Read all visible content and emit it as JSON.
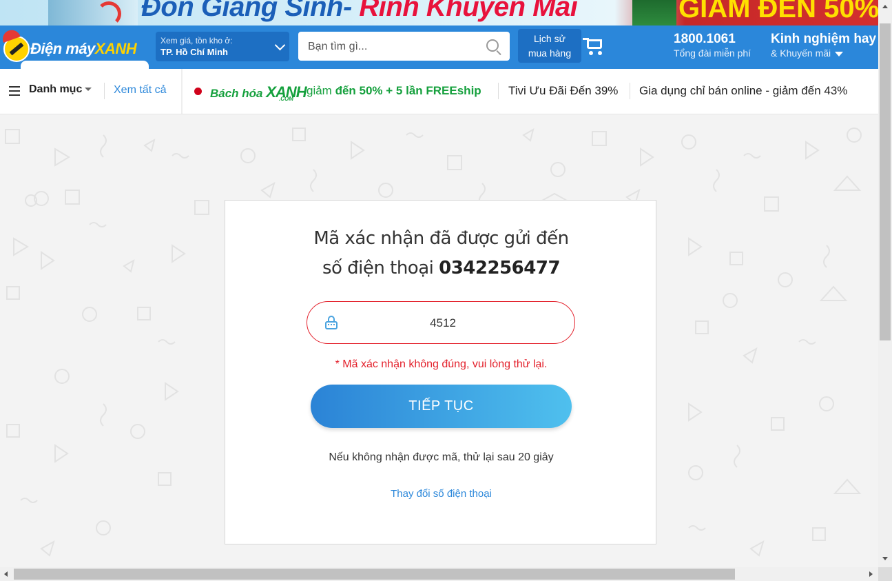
{
  "banner": {
    "title_blue": "Đón Giáng Sinh- ",
    "title_red": "Rinh Khuyến Mãi",
    "right_text": "GIẢM ĐẾN 50%"
  },
  "header": {
    "logo_text_main": "Điện máy",
    "logo_text_brand": "XANH",
    "location_label": "Xem giá, tồn kho ở:",
    "location_value": "TP. Hồ Chí Minh",
    "search_placeholder": "Bạn tìm gì...",
    "history_line1": "Lịch sử",
    "history_line2": "mua hàng",
    "hotline_number": "1800.1061",
    "hotline_label": "Tổng đài miễn phí",
    "promo_title": "Kinh nghiệm hay",
    "promo_sub": "& Khuyến mãi"
  },
  "nav": {
    "category_label": "Danh mục",
    "see_all": "Xem tất cả",
    "bhx_brand_a": "Bách hóa ",
    "bhx_brand_b": "XANH",
    "bhx_com": ".COM",
    "deal1_prefix": " giảm ",
    "deal1_bold": "đến 50% + 5 lần FREEship",
    "deal2": "Tivi Ưu Đãi Đến 39%",
    "deal3": "Gia dụng chỉ bán online - giảm đến 43%"
  },
  "verify": {
    "message_line1": "Mã xác nhận đã được gửi đến",
    "message_line2_prefix": "số điện thoại ",
    "phone": "0342256477",
    "code_value": "4512",
    "error": "* Mã xác nhận không đúng, vui lòng thử lại.",
    "continue_label": "TIẾP TỤC",
    "retry_text": "Nếu không nhận được mã, thử lại sau 20 giây",
    "change_phone": "Thay đổi số điện thoại"
  },
  "icons": {
    "search": "search-icon",
    "cart": "cart-icon",
    "menu": "hamburger-icon",
    "lock": "lock-icon"
  },
  "colors": {
    "brand_blue": "#2b87da",
    "error_red": "#e3202b",
    "bhx_green": "#15a03d"
  }
}
